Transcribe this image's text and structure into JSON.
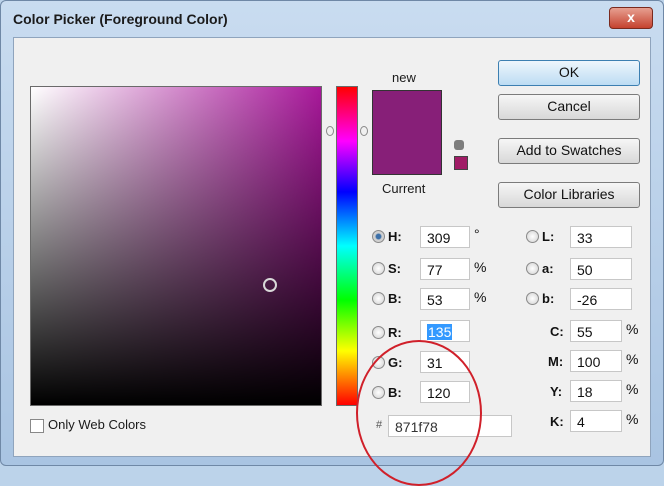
{
  "window": {
    "title": "Color Picker (Foreground Color)",
    "close_glyph": "x"
  },
  "swatches": {
    "new_label": "new",
    "current_label": "Current",
    "new_color": "#871f78",
    "current_color": "#871f78"
  },
  "buttons": {
    "ok": "OK",
    "cancel": "Cancel",
    "add": "Add to Swatches",
    "libraries": "Color Libraries"
  },
  "hsb": [
    {
      "key": "H:",
      "value": "309",
      "unit": "°",
      "selected": true
    },
    {
      "key": "S:",
      "value": "77",
      "unit": "%",
      "selected": false
    },
    {
      "key": "B:",
      "value": "53",
      "unit": "%",
      "selected": false
    }
  ],
  "rgb": [
    {
      "key": "R:",
      "value": "135"
    },
    {
      "key": "G:",
      "value": "31"
    },
    {
      "key": "B:",
      "value": "120"
    }
  ],
  "lab": [
    {
      "key": "L:",
      "value": "33"
    },
    {
      "key": "a:",
      "value": "50"
    },
    {
      "key": "b:",
      "value": "-26"
    }
  ],
  "cmyk": [
    {
      "key": "C:",
      "value": "55",
      "unit": "%"
    },
    {
      "key": "M:",
      "value": "100",
      "unit": "%"
    },
    {
      "key": "Y:",
      "value": "18",
      "unit": "%"
    },
    {
      "key": "K:",
      "value": "4",
      "unit": "%"
    }
  ],
  "hex": {
    "prefix": "#",
    "value": "871f78"
  },
  "web_only": {
    "label": "Only Web Colors",
    "checked": false
  },
  "colors": {
    "field_hue": "#a8189a",
    "accent_selection": "#3399ff",
    "annotation": "#d0202a"
  }
}
